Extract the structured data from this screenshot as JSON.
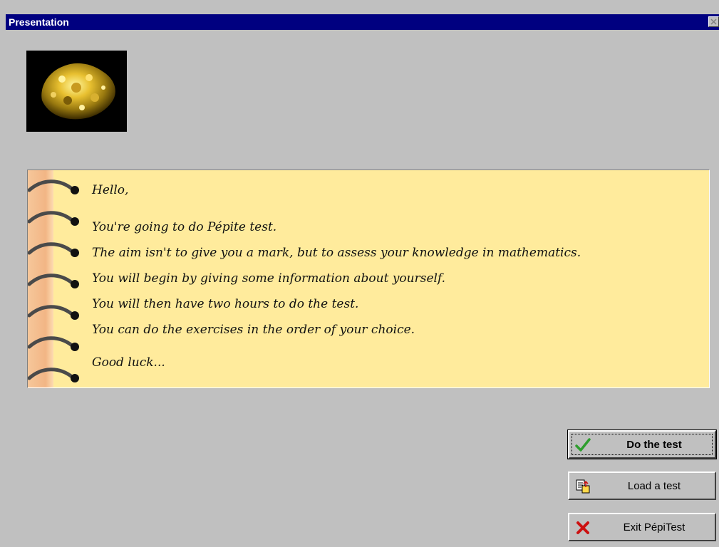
{
  "window": {
    "title": "Presentation"
  },
  "message": {
    "lines": [
      "Hello,",
      "You're going to do Pépite test.",
      "The aim isn't to give you a mark, but to assess your knowledge in mathematics.",
      "You will begin by giving some information about yourself.",
      "You will then have two hours to do the test.",
      "You can do the exercises in the order of your choice.",
      "Good luck..."
    ]
  },
  "buttons": {
    "do_test": {
      "label": "Do the test",
      "icon": "check-icon"
    },
    "load_test": {
      "label": "Load a test",
      "icon": "load-file-icon"
    },
    "exit": {
      "label": "Exit PépiTest",
      "icon": "red-x-icon"
    }
  },
  "colors": {
    "title_bar": "#000080",
    "notebook_paper": "#ffeb9c",
    "margin": "#f4bf90",
    "check": "#2e9e2e",
    "exit_x": "#cc1111"
  }
}
